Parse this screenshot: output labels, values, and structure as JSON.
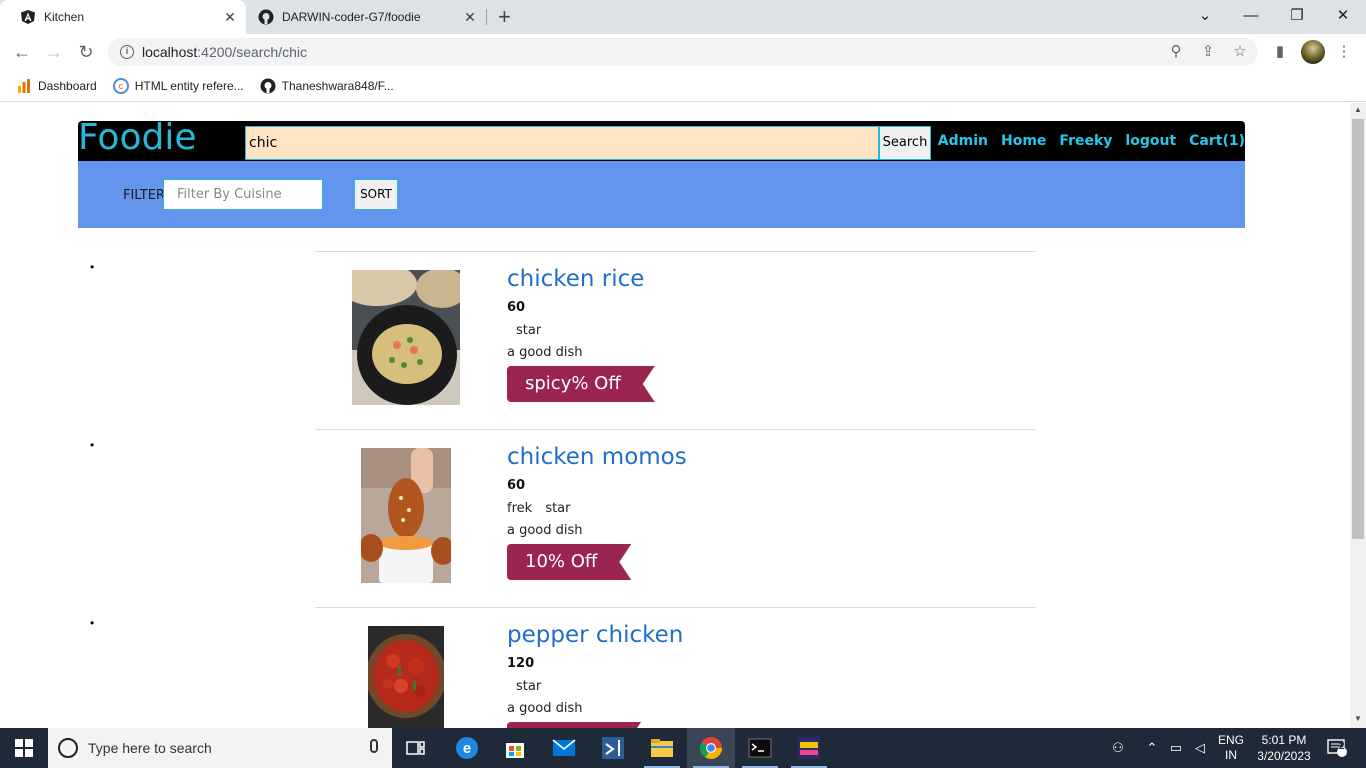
{
  "browser": {
    "tabs": [
      {
        "title": "Kitchen",
        "active": true,
        "icon": "angular-icon"
      },
      {
        "title": "DARWIN-coder-G7/foodie",
        "active": false,
        "icon": "github-icon"
      }
    ],
    "url_host": "localhost",
    "url_path": ":4200/search/chic",
    "bookmarks": [
      {
        "label": "Dashboard",
        "icon": "analytics-icon"
      },
      {
        "label": "HTML entity refere...",
        "icon": "web-icon"
      },
      {
        "label": "Thaneshwara848/F...",
        "icon": "github-icon"
      }
    ]
  },
  "app": {
    "logo": "Foodie",
    "search_value": "chic",
    "search_button": "Search",
    "nav": [
      "Admin",
      "Home",
      "Freeky",
      "logout",
      "Cart(1)"
    ],
    "filter_label": "FILTER",
    "filter_placeholder": "Filter By Cuisine",
    "sort_button": "SORT",
    "bullet": "•",
    "results": [
      {
        "name": "chicken rice",
        "price": "60",
        "tags": [
          "",
          "star"
        ],
        "description": "a good dish",
        "offer": "spicy% Off"
      },
      {
        "name": "chicken momos",
        "price": "60",
        "tags": [
          "frek",
          "star"
        ],
        "description": "a good dish",
        "offer": "10% Off"
      },
      {
        "name": "pepper chicken",
        "price": "120",
        "tags": [
          "",
          "star"
        ],
        "description": "a good dish",
        "offer": ""
      }
    ]
  },
  "taskbar": {
    "search_placeholder": "Type here to search",
    "lang": "ENG",
    "region": "IN",
    "time": "5:01 PM",
    "date": "3/20/2023",
    "notifications": "2"
  },
  "colors": {
    "header_bg": "#000000",
    "logo": "#29b6d8",
    "filter_bar": "#6495ed",
    "search_bg": "#ffe4c4",
    "link": "#1f6fc8",
    "ribbon": "#9a2550"
  }
}
